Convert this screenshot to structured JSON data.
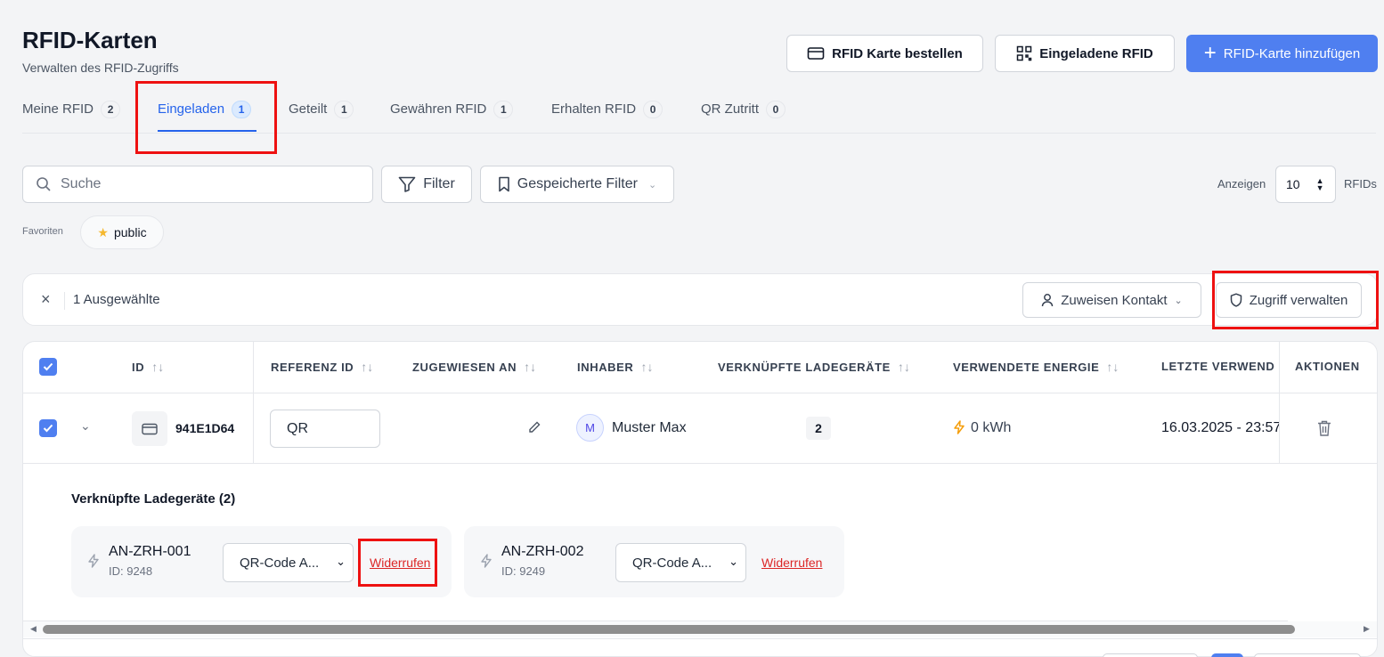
{
  "header": {
    "title": "RFID-Karten",
    "subtitle": "Verwalten des RFID-Zugriffs",
    "order_button": "RFID Karte bestellen",
    "invited_button": "Eingeladene RFID",
    "add_button": "RFID-Karte hinzufügen"
  },
  "tabs": [
    {
      "label": "Meine RFID",
      "count": "2"
    },
    {
      "label": "Eingeladen",
      "count": "1"
    },
    {
      "label": "Geteilt",
      "count": "1"
    },
    {
      "label": "Gewähren RFID",
      "count": "1"
    },
    {
      "label": "Erhalten RFID",
      "count": "0"
    },
    {
      "label": "QR Zutritt",
      "count": "0"
    }
  ],
  "toolbar": {
    "search_placeholder": "Suche",
    "filter_label": "Filter",
    "saved_filter_label": "Gespeicherte Filter",
    "show_label": "Anzeigen",
    "page_size": "10",
    "unit_label": "RFIDs"
  },
  "favorites": {
    "label": "Favoriten",
    "chip": "public"
  },
  "selection": {
    "count_text": "1 Ausgewählte",
    "assign_contact": "Zuweisen Kontakt",
    "manage_access": "Zugriff verwalten"
  },
  "table": {
    "columns": {
      "id": "ID",
      "reference": "REFERENZ ID",
      "assigned": "ZUGEWIESEN AN",
      "owner": "INHABER",
      "linked": "VERKNÜPFTE LADEGERÄTE",
      "energy": "VERWENDETE ENERGIE",
      "last_used": "LETZTE VERWEND",
      "actions": "AKTIONEN"
    },
    "row": {
      "id": "941E1D64",
      "reference": "QR",
      "owner_initial": "M",
      "owner": "Muster Max",
      "linked_count": "2",
      "energy": "0 kWh",
      "last_used": "16.03.2025 - 23:57"
    },
    "expanded": {
      "title": "Verknüpfte Ladegeräte (2)",
      "devices": [
        {
          "name": "AN-ZRH-001",
          "id": "ID: 9248",
          "select": "QR-Code A...",
          "revoke": "Widerrufen"
        },
        {
          "name": "AN-ZRH-002",
          "id": "ID: 9249",
          "select": "QR-Code A...",
          "revoke": "Widerrufen"
        }
      ]
    }
  },
  "colors": {
    "accent": "#4f7ff0",
    "highlight_box": "#ee1111",
    "danger": "#dc2626",
    "energy_icon": "#f59e0b"
  }
}
